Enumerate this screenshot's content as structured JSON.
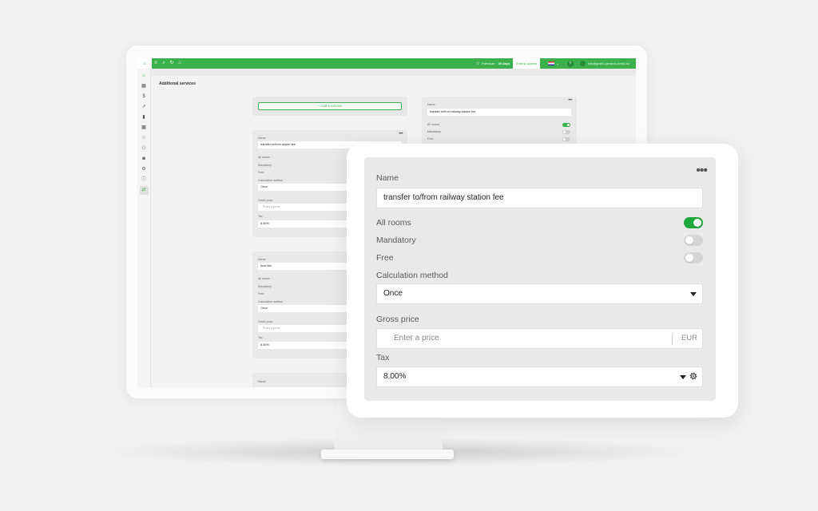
{
  "app": {
    "topbar": {
      "plan_label": "Premium",
      "plan_days": "30 days",
      "extend_label": "Extend access",
      "language_caret": "⌄",
      "help_label": "?",
      "user_email": "info@grand-pension-trebic.cz"
    },
    "page_title": "Additional services",
    "add_service_label": "+ Add a service",
    "cards": [
      {
        "name_label": "Name",
        "name_value": "transfer to/from airport fee",
        "all_rooms_label": "All rooms",
        "mandatory_label": "Mandatory",
        "free_label": "Free",
        "calc_label": "Calculation method",
        "calc_value": "Once",
        "gross_label": "Gross price",
        "price_placeholder": "Enter a price",
        "tax_label": "Tax",
        "tax_value": "8.00%"
      },
      {
        "name_label": "Name",
        "name_value": "food fee",
        "all_rooms_label": "All rooms",
        "mandatory_label": "Mandatory",
        "free_label": "Free",
        "calc_label": "Calculation method",
        "calc_value": "Once",
        "gross_label": "Gross price",
        "price_placeholder": "Enter a price",
        "tax_label": "Tax",
        "tax_value": "8.00%"
      },
      {
        "name_label": "Name"
      },
      {
        "name_label": "Name",
        "name_value": "transfer to/from railway station fee",
        "all_rooms_label": "All rooms",
        "mandatory_label": "Mandatory",
        "free_label": "Free"
      }
    ]
  },
  "detail": {
    "name_label": "Name",
    "name_value": "transfer to/from railway station fee",
    "all_rooms_label": "All rooms",
    "all_rooms_on": true,
    "mandatory_label": "Mandatory",
    "mandatory_on": false,
    "free_label": "Free",
    "free_on": false,
    "calc_label": "Calculation method",
    "calc_value": "Once",
    "gross_label": "Gross price",
    "price_placeholder": "Enter a price",
    "currency": "EUR",
    "tax_label": "Tax",
    "tax_value": "8.00%",
    "menu_glyph": "•••"
  },
  "colors": {
    "brand_green": "#3bb04c",
    "toggle_on": "#1fa83d",
    "card_bg": "#e9e9e9"
  },
  "icons": [
    "logo-icon",
    "menu-icon",
    "search-icon",
    "refresh-icon",
    "home-icon",
    "star-icon",
    "flag-icon",
    "help-icon",
    "avatar-icon",
    "more-icon",
    "caret-down-icon",
    "gear-icon"
  ]
}
